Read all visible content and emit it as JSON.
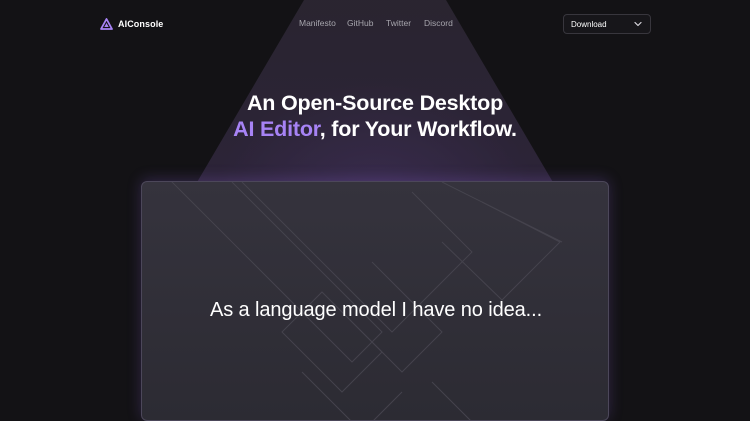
{
  "brand": {
    "name": "AIConsole",
    "logo_icon": "triangle-logo-icon"
  },
  "nav": {
    "links": [
      "Manifesto",
      "GitHub",
      "Twitter",
      "Discord"
    ]
  },
  "download": {
    "label": "Download",
    "icon": "chevron-down-icon"
  },
  "hero": {
    "line1": "An Open-Source Desktop",
    "accent": "AI Editor",
    "line2_rest": ", for Your Workflow."
  },
  "preview": {
    "text": "As a language model I have no idea..."
  },
  "colors": {
    "background": "#131215",
    "accent": "#a783f5",
    "card": "#302f37"
  }
}
